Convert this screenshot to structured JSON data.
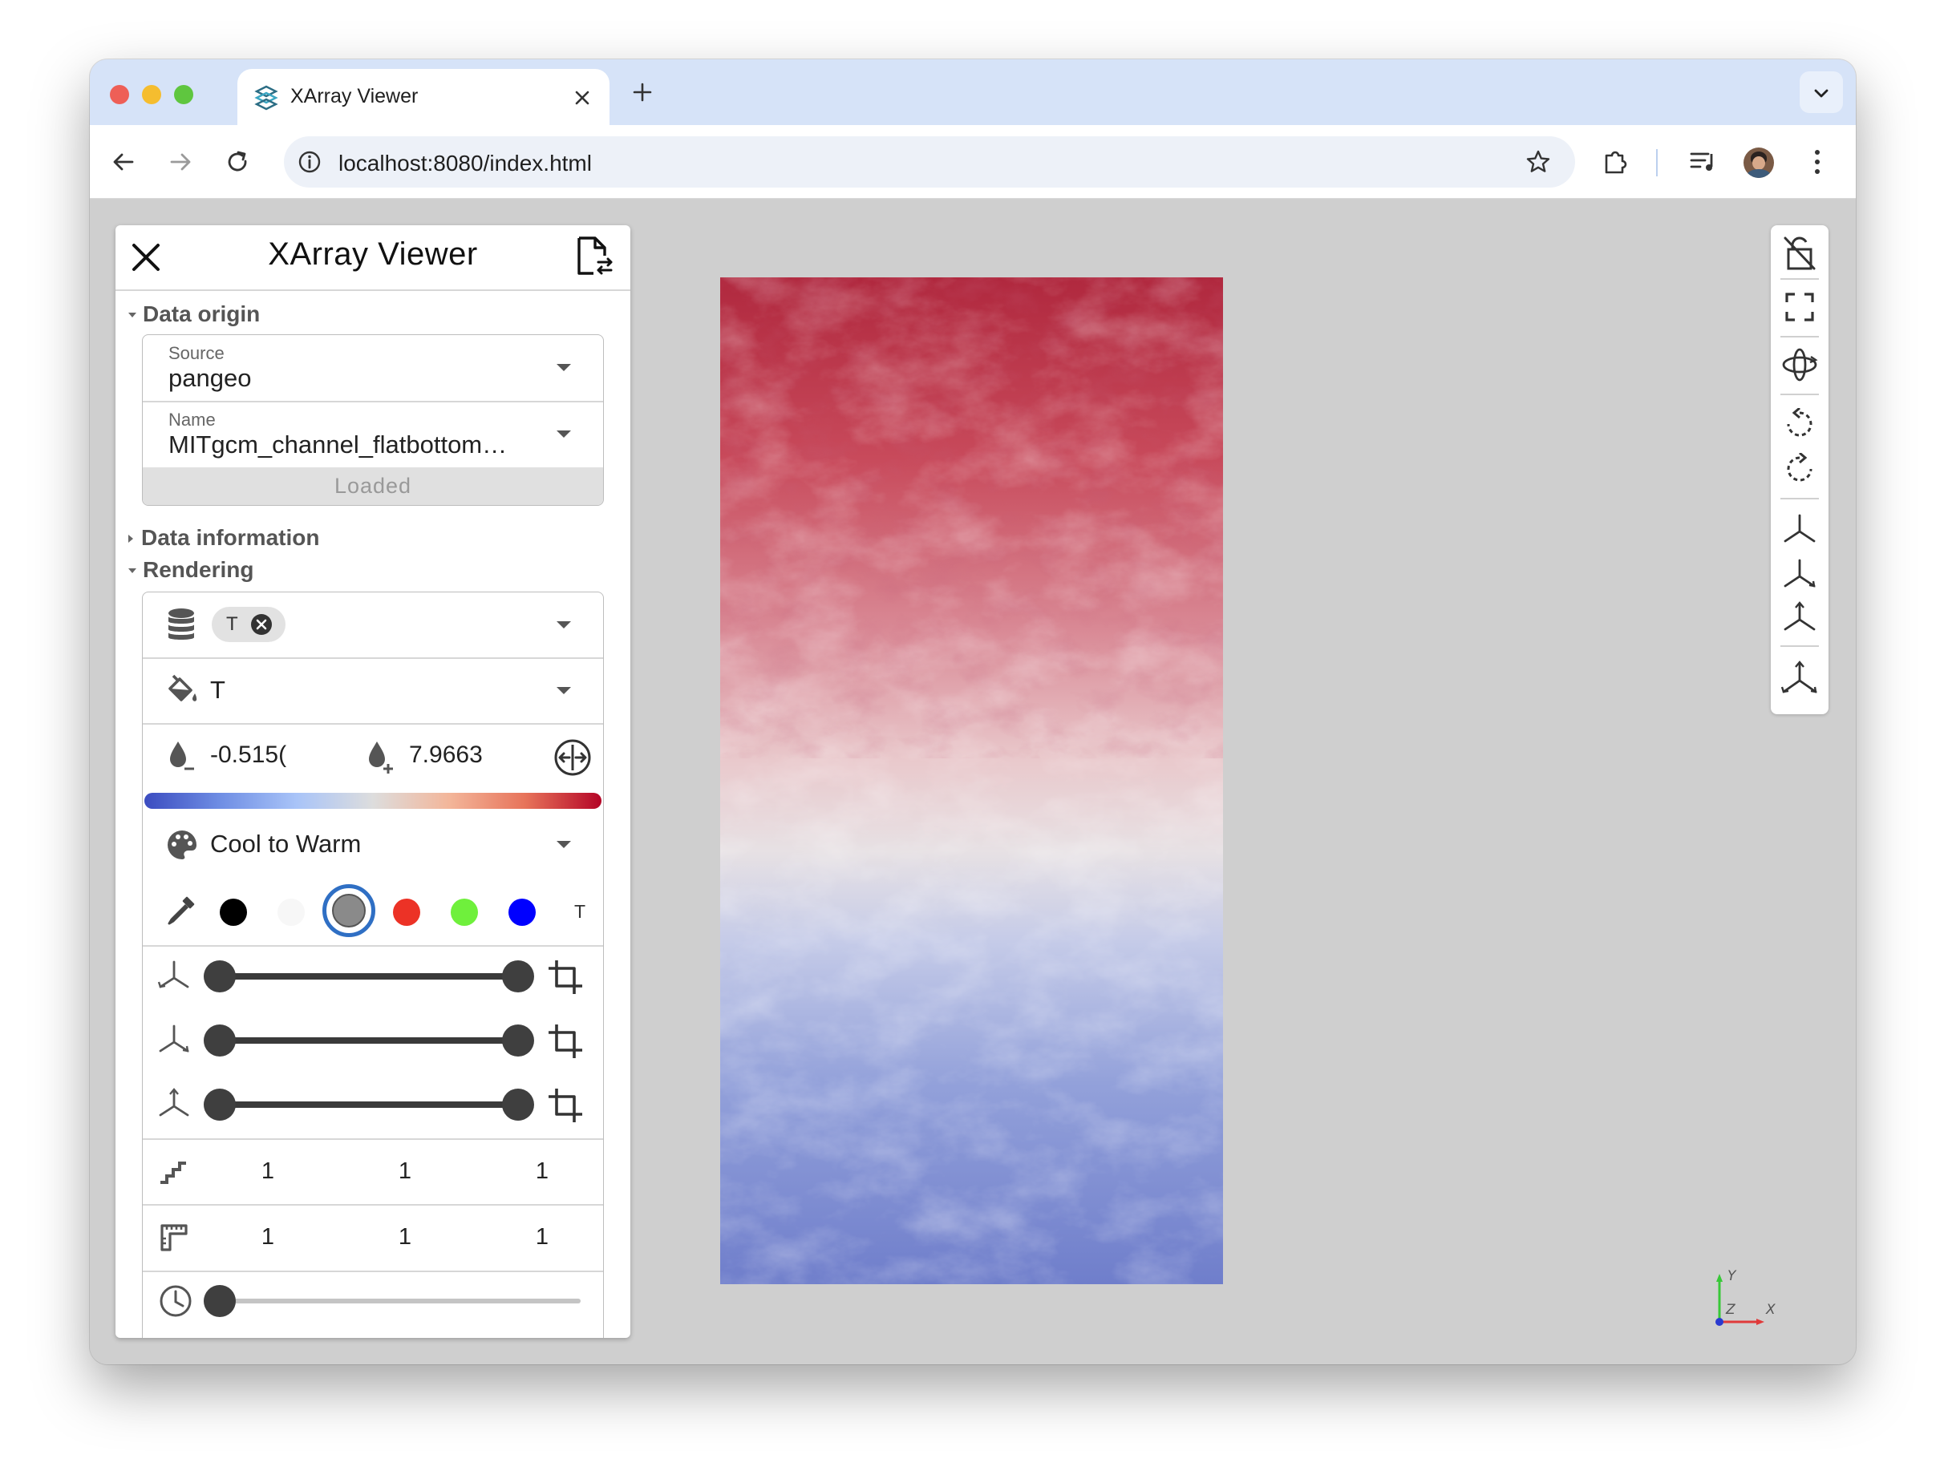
{
  "browser": {
    "tab_title": "XArray Viewer",
    "url": "localhost:8080/index.html",
    "traffic_colors": [
      "#ee5f57",
      "#f5bd2f",
      "#5fc63f"
    ]
  },
  "panel": {
    "title": "XArray Viewer",
    "data_origin": {
      "heading": "Data origin",
      "source_label": "Source",
      "source_value": "pangeo",
      "name_label": "Name",
      "name_value": "MITgcm_channel_flatbottom…",
      "loaded_label": "Loaded"
    },
    "data_information": {
      "heading": "Data information"
    },
    "rendering": {
      "heading": "Rendering",
      "array_chip": "T",
      "color_by": "T",
      "range_min": "-0.515(",
      "range_max": "7.9663",
      "colormap": "Cool to Warm",
      "swatches": [
        "#000000",
        "#f7f7f7",
        "#8a8a8a",
        "#ec3226",
        "#6ff03c",
        "#0000ff"
      ],
      "selected_swatch": 2,
      "swatch_tail_label": "T",
      "crop_ranges": [
        {
          "axis": "x",
          "start": 0,
          "end": 1
        },
        {
          "axis": "y",
          "start": 0,
          "end": 1
        },
        {
          "axis": "z",
          "start": 0,
          "end": 1
        }
      ],
      "stride": [
        "1",
        "1",
        "1"
      ],
      "scale": [
        "1",
        "1",
        "1"
      ],
      "time_index": 0
    }
  },
  "viewer": {
    "colormap_colors": [
      "#3b4cc0",
      "#dddddd",
      "#b40426"
    ],
    "axes_labels": {
      "y": "Y",
      "z": "Z",
      "x": "X"
    }
  }
}
